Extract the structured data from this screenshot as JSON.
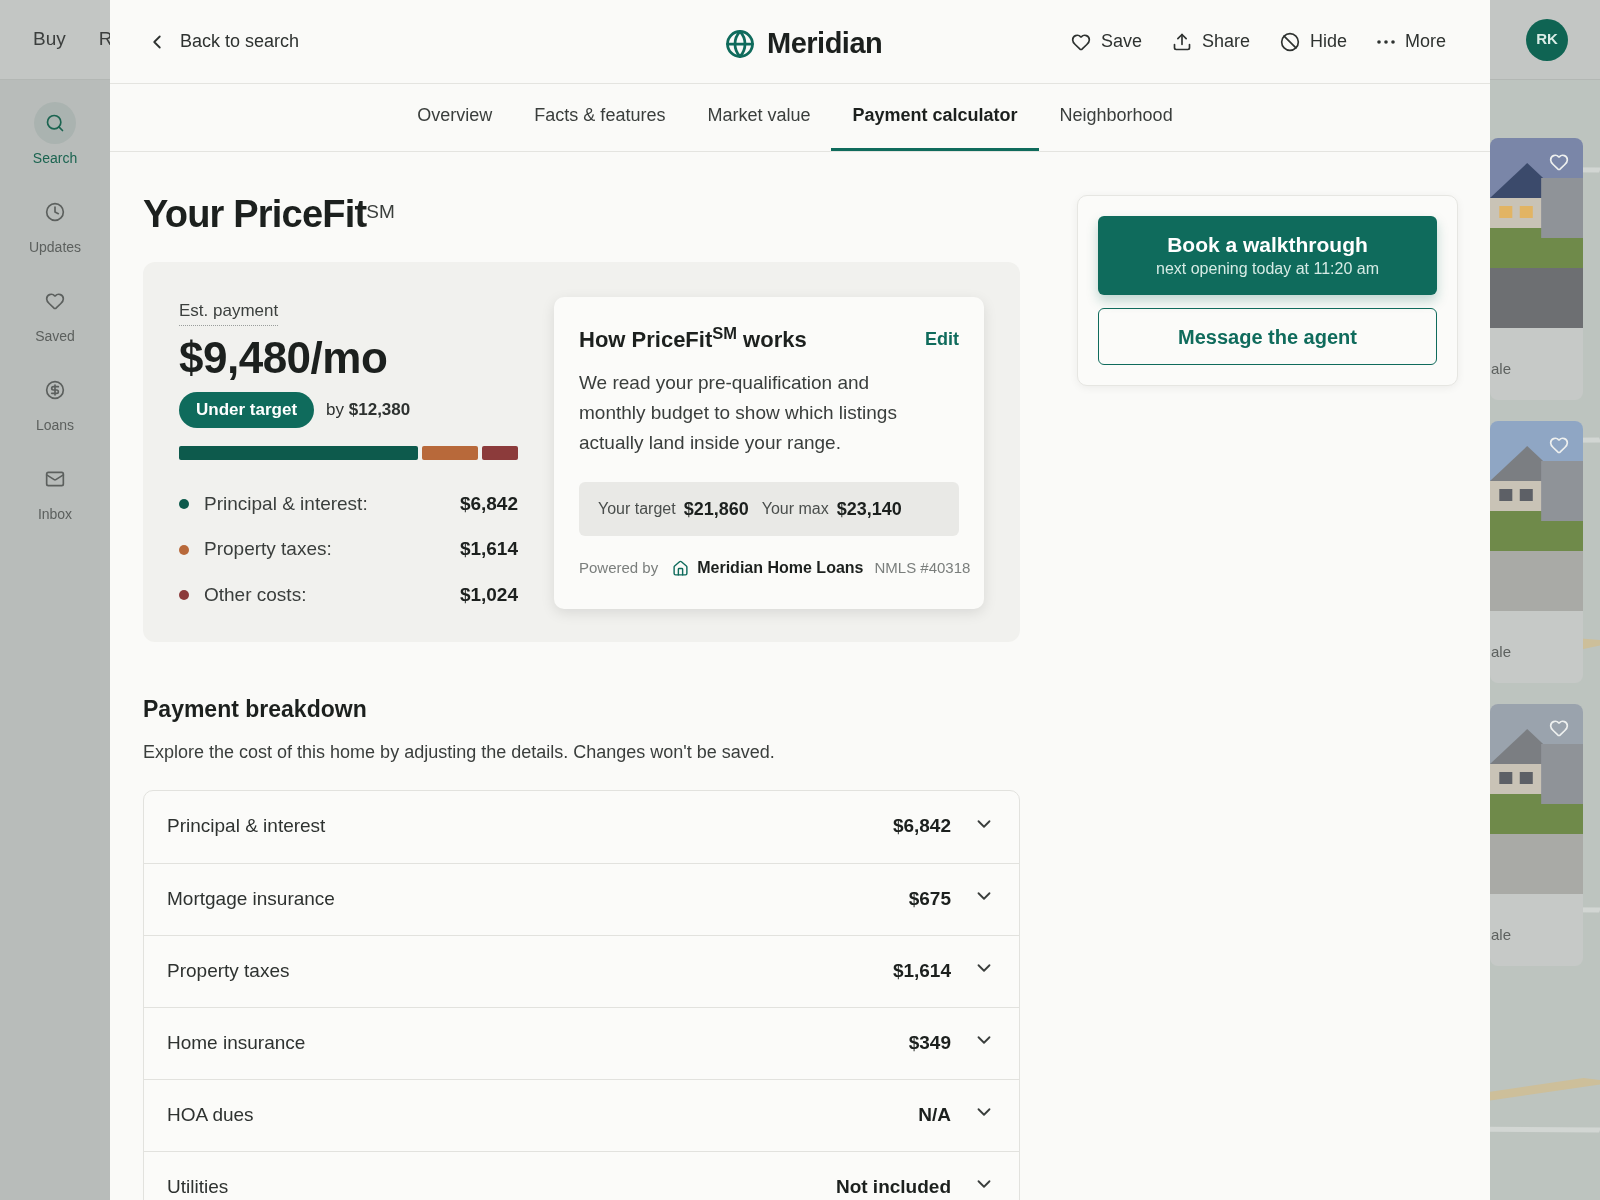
{
  "background": {
    "top_nav": [
      "Buy",
      "R"
    ],
    "avatar": "RK",
    "sidebar": [
      {
        "kind": "search",
        "label": "Search",
        "selected": true
      },
      {
        "kind": "clock",
        "label": "Updates",
        "selected": false
      },
      {
        "kind": "heart",
        "label": "Saved",
        "selected": false
      },
      {
        "kind": "dollar",
        "label": "Loans",
        "selected": false
      },
      {
        "kind": "mail",
        "label": "Inbox",
        "selected": false
      }
    ],
    "listings": [
      {
        "status": "ale"
      },
      {
        "status": "ale"
      },
      {
        "status": "ale"
      }
    ]
  },
  "header": {
    "back": "Back to search",
    "brand": "Meridian",
    "actions": [
      {
        "kind": "heart",
        "label": "Save"
      },
      {
        "kind": "share",
        "label": "Share"
      },
      {
        "kind": "hide",
        "label": "Hide"
      },
      {
        "kind": "more",
        "label": "More"
      }
    ]
  },
  "tabs": [
    {
      "label": "Overview",
      "selected": false
    },
    {
      "label": "Facts & features",
      "selected": false
    },
    {
      "label": "Market value",
      "selected": false
    },
    {
      "label": "Payment calculator",
      "selected": true
    },
    {
      "label": "Neighborhood",
      "selected": false
    }
  ],
  "pricefit": {
    "title": "Your PriceFit$^{SM}$",
    "est_label": "Est. payment",
    "est_value": "$9,480/mo",
    "badge": "Under target",
    "delta": "by **$12,380**",
    "items": [
      {
        "label": "Principal & interest:",
        "amount": "$6,842",
        "color": "#0d5a4c"
      },
      {
        "label": "Property taxes:",
        "amount": "$1,614",
        "color": "#b8693a"
      },
      {
        "label": "Other costs:",
        "amount": "$1,024",
        "color": "#8c3b3b"
      }
    ],
    "how": {
      "title": "How PriceFit$^{SM}$ works",
      "edit": "Edit",
      "body": "We read your pre-qualification and monthly budget to show which listings actually land inside your range.",
      "target_label": "Your target",
      "target": "$21,860",
      "max_label": "Your max",
      "max": "$23,140",
      "powered_by": "Powered by",
      "lender": "Meridian Home Loans",
      "nmls": "NMLS #40318"
    }
  },
  "breakdown": {
    "title": "Payment breakdown",
    "description": "Explore the cost of this home by adjusting the details. Changes won't be saved.",
    "rows": [
      {
        "label": "Principal & interest",
        "value": "$6,842",
        "expanded": false
      },
      {
        "label": "Mortgage insurance",
        "value": "$675",
        "expanded": false
      },
      {
        "label": "Property taxes",
        "value": "$1,614",
        "expanded": false
      },
      {
        "label": "Home insurance",
        "value": "$349",
        "expanded": false
      },
      {
        "label": "HOA dues",
        "value": "N/A",
        "expanded": false
      },
      {
        "label": "Utilities",
        "value": "Not included",
        "expanded": false
      }
    ]
  },
  "contact": {
    "primary": "Book a walkthrough",
    "primary_sub": "next opening today at 11:20 am",
    "secondary": "Message the agent"
  }
}
